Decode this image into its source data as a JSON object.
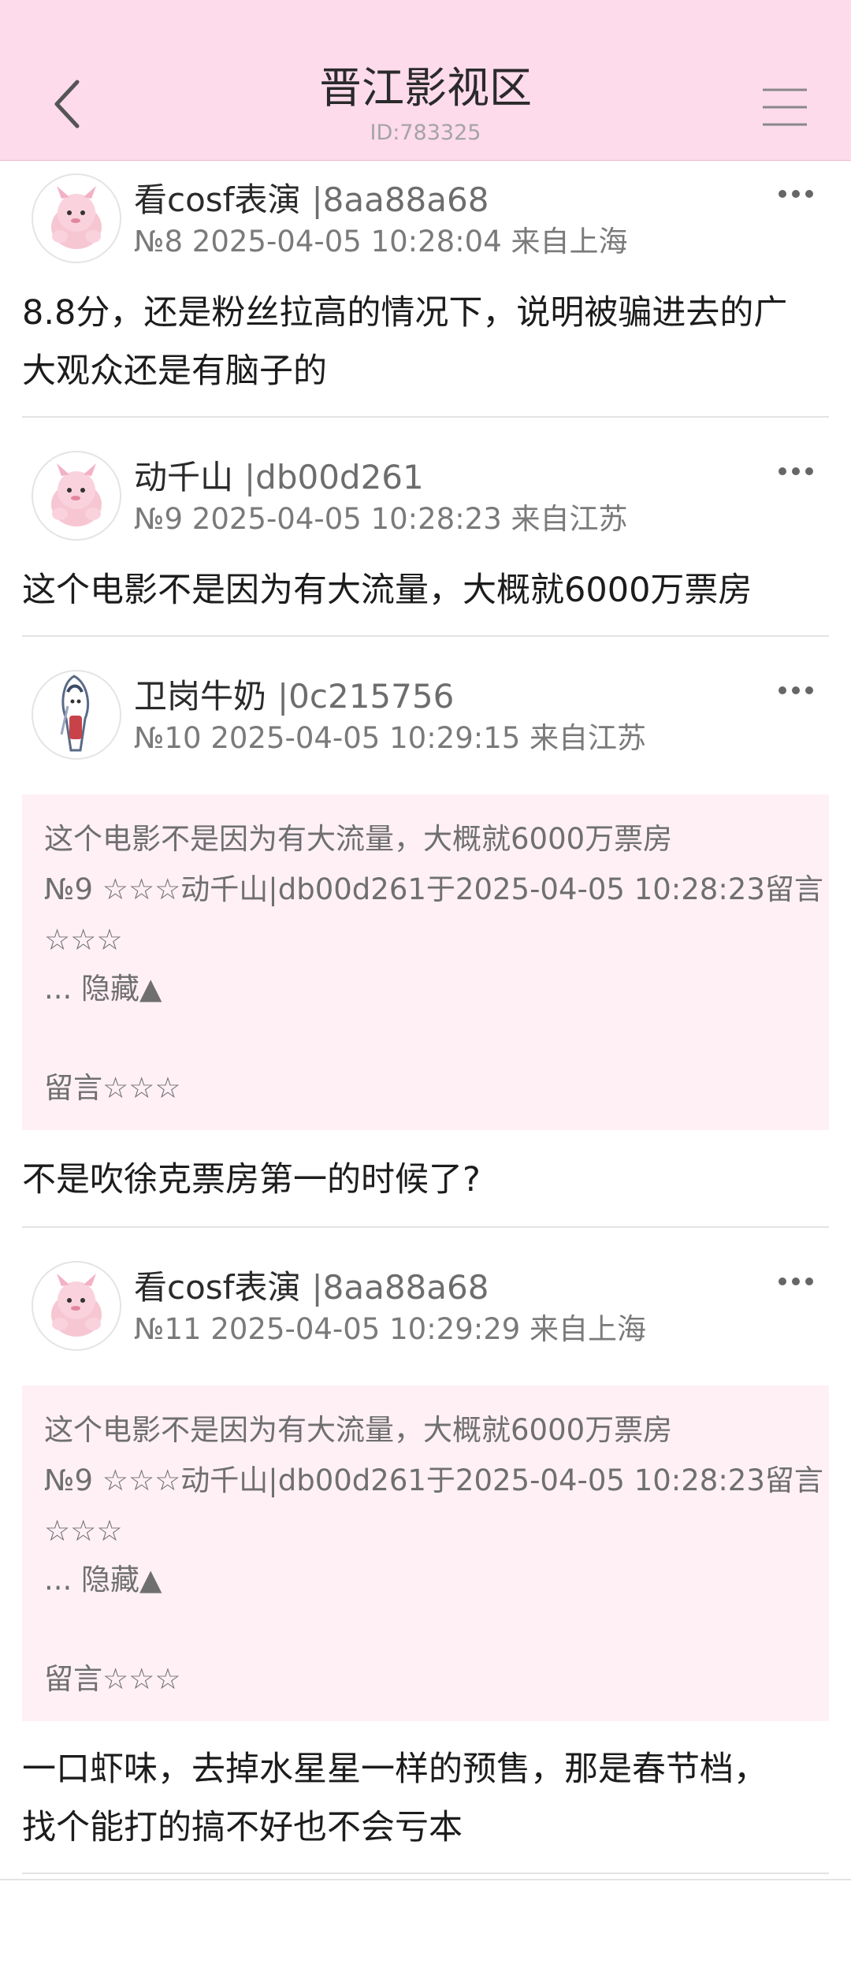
{
  "header": {
    "title": "晋江影视区",
    "id_text": "ID:783325",
    "back_icon": "chevron-left-icon",
    "menu_icon": "hamburger-menu-icon",
    "background": "#fddbeb"
  },
  "posts": [
    {
      "avatar": "pink-pokemon-avatar",
      "name": "看cosf表演",
      "user_id": "|8aa88a68",
      "meta": "№8 2025-04-05 10:28:04 来自上海",
      "body_lines": [
        "8.8分，还是粉丝拉高的情况下，说明被骗进去的广",
        "大观众还是有脑子的"
      ]
    },
    {
      "avatar": "pink-pokemon-avatar",
      "name": "动千山",
      "user_id": "|db00d261",
      "meta": "№9 2025-04-05 10:28:23 来自江苏",
      "body_lines": [
        "这个电影不是因为有大流量，大概就6000万票房"
      ]
    },
    {
      "avatar": "anime-character-avatar",
      "name": "卫岗牛奶",
      "user_id": "|0c215756",
      "meta": "№10 2025-04-05 10:29:15 来自江苏",
      "quote": {
        "text": "这个电影不是因为有大流量，大概就6000万票房",
        "ref": "№9 ☆☆☆动千山|db00d261于2025-04-05 10:28:23留言",
        "ref_cont": "☆☆☆",
        "hide": "... 隐藏▲",
        "footer": "留言☆☆☆"
      },
      "body_lines": [
        "不是吹徐克票房第一的时候了?"
      ]
    },
    {
      "avatar": "pink-pokemon-avatar",
      "name": "看cosf表演",
      "user_id": "|8aa88a68",
      "meta": "№11 2025-04-05 10:29:29 来自上海",
      "quote": {
        "text": "这个电影不是因为有大流量，大概就6000万票房",
        "ref": "№9 ☆☆☆动千山|db00d261于2025-04-05 10:28:23留言",
        "ref_cont": "☆☆☆",
        "hide": "... 隐藏▲",
        "footer": "留言☆☆☆"
      },
      "body_lines": [
        "一口虾味，去掉水星星一样的预售，那是春节档，",
        "找个能打的搞不好也不会亏本"
      ]
    }
  ],
  "more_icon": "more-dots-icon"
}
